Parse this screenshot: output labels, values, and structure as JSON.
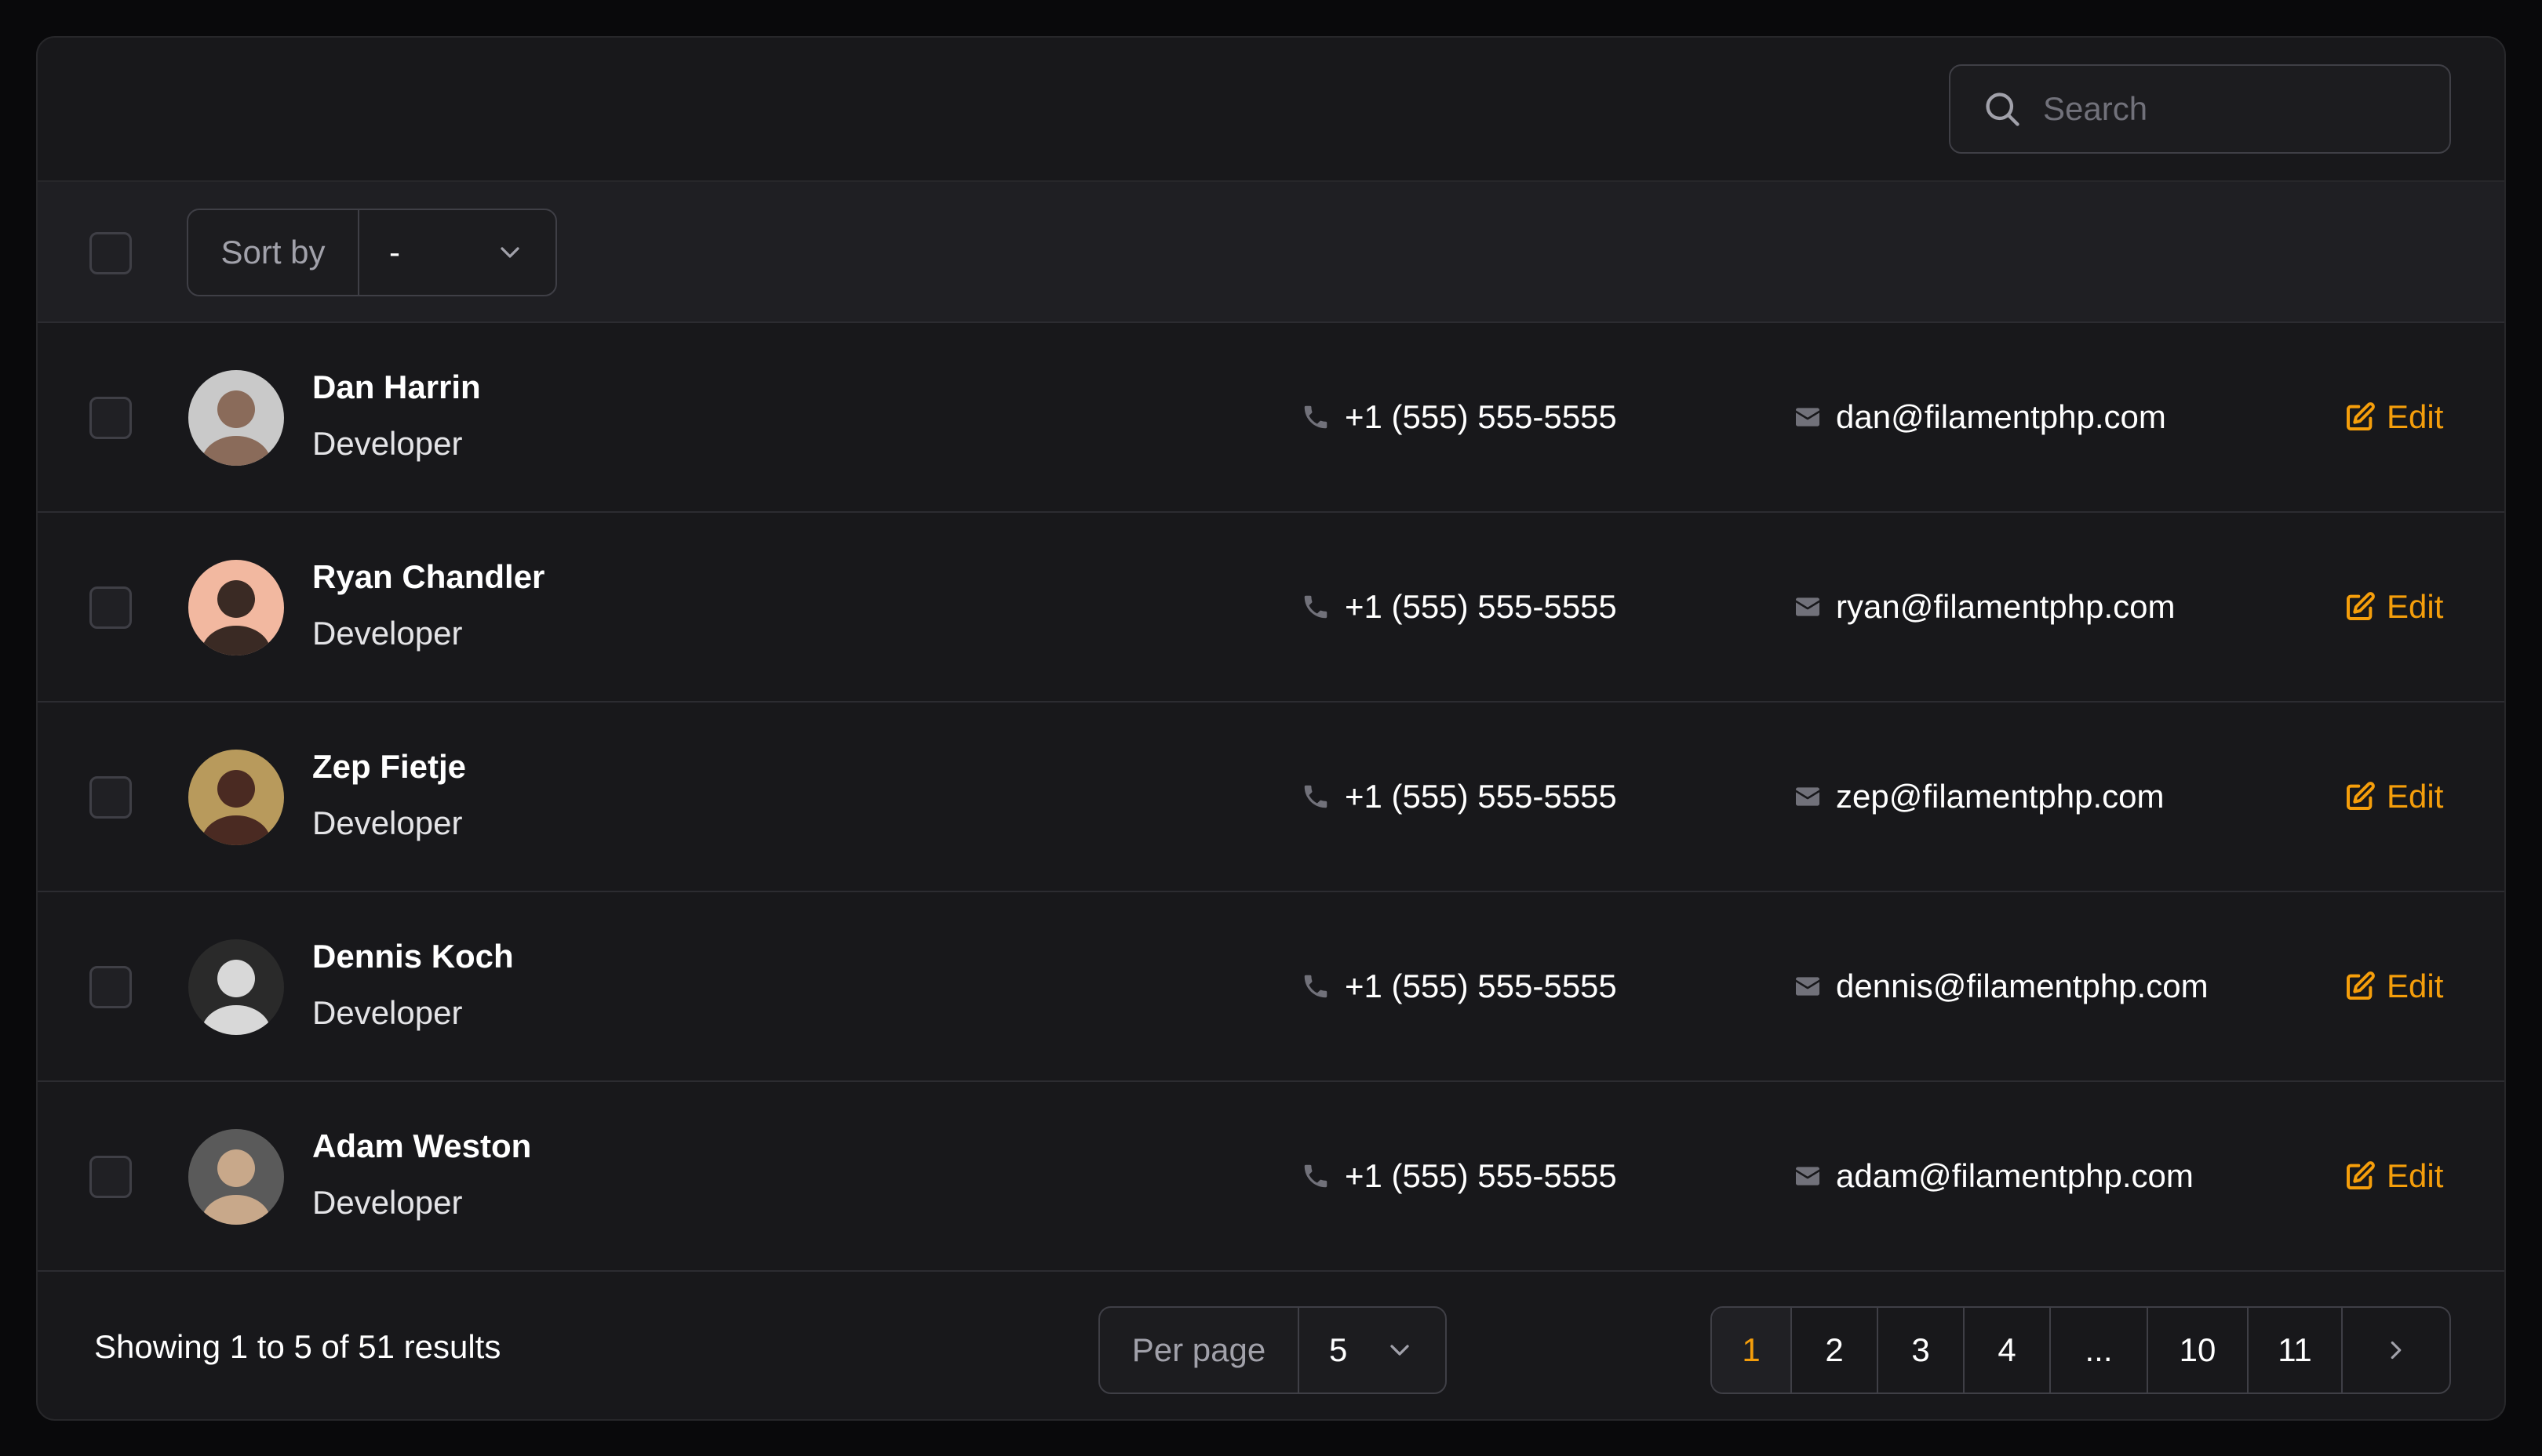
{
  "search": {
    "placeholder": "Search"
  },
  "toolbar": {
    "sort_label": "Sort by",
    "sort_value": "-"
  },
  "rows": [
    {
      "name": "Dan Harrin",
      "role": "Developer",
      "phone": "+1 (555) 555-5555",
      "email": "dan@filamentphp.com",
      "action": "Edit",
      "avatar_bg": "#c9c9c9",
      "avatar_fg": "#8a6b5a"
    },
    {
      "name": "Ryan Chandler",
      "role": "Developer",
      "phone": "+1 (555) 555-5555",
      "email": "ryan@filamentphp.com",
      "action": "Edit",
      "avatar_bg": "#f2b8a0",
      "avatar_fg": "#3a2a24"
    },
    {
      "name": "Zep Fietje",
      "role": "Developer",
      "phone": "+1 (555) 555-5555",
      "email": "zep@filamentphp.com",
      "action": "Edit",
      "avatar_bg": "#b89a5c",
      "avatar_fg": "#4a2a22"
    },
    {
      "name": "Dennis Koch",
      "role": "Developer",
      "phone": "+1 (555) 555-5555",
      "email": "dennis@filamentphp.com",
      "action": "Edit",
      "avatar_bg": "#2a2a2a",
      "avatar_fg": "#d8d8d8"
    },
    {
      "name": "Adam Weston",
      "role": "Developer",
      "phone": "+1 (555) 555-5555",
      "email": "adam@filamentphp.com",
      "action": "Edit",
      "avatar_bg": "#5a5a5a",
      "avatar_fg": "#c8a88a"
    }
  ],
  "footer": {
    "showing": "Showing 1 to 5 of 51 results",
    "per_page_label": "Per page",
    "per_page_value": "5"
  },
  "pagination": {
    "pages": [
      "1",
      "2",
      "3",
      "4",
      "...",
      "10",
      "11"
    ],
    "active": "1"
  },
  "colors": {
    "accent": "#f59e0b",
    "background": "#18181b",
    "border": "#3f3f46"
  },
  "icons": {
    "search": "search-icon",
    "chevron": "chevron-down-icon",
    "phone": "phone-icon",
    "email": "envelope-icon",
    "edit": "pencil-square-icon",
    "next": "chevron-right-icon"
  }
}
